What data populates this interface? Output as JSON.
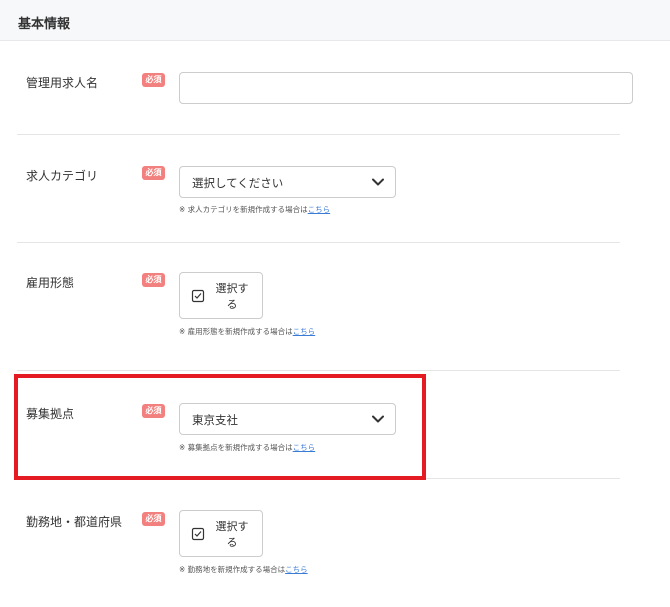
{
  "header": {
    "title": "基本情報"
  },
  "required_badge": "必須",
  "fields": {
    "job_name": {
      "label": "管理用求人名",
      "value": ""
    },
    "category": {
      "label": "求人カテゴリ",
      "select_value": "選択してください",
      "note_prefix": "※ 求人カテゴリを新規作成する場合は",
      "note_link": "こちら"
    },
    "employment": {
      "label": "雇用形態",
      "button_line1": "選択す",
      "button_line2": "る",
      "note_prefix": "※ 雇用形態を新規作成する場合は",
      "note_link": "こちら"
    },
    "base": {
      "label": "募集拠点",
      "select_value": "東京支社",
      "note_prefix": "※ 募集拠点を新規作成する場合は",
      "note_link": "こちら"
    },
    "location": {
      "label": "勤務地・都道府県",
      "button_line1": "選択す",
      "button_line2": "る",
      "note_prefix": "※ 勤務地を新規作成する場合は",
      "note_link": "こちら"
    }
  },
  "colors": {
    "required": "#f2807e",
    "highlight": "#e51b24",
    "link": "#3a7bd5"
  }
}
